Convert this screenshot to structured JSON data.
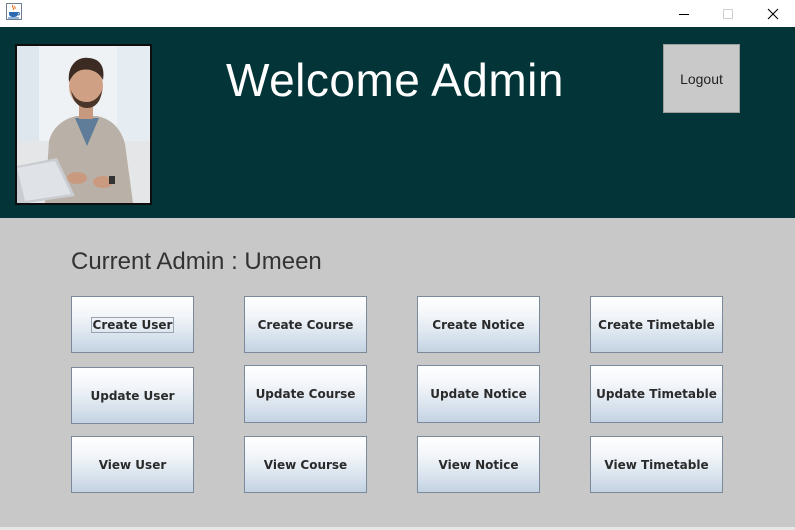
{
  "window": {
    "title": "",
    "icon": "java-cup-icon",
    "controls": [
      "minimize",
      "maximize",
      "close"
    ]
  },
  "header": {
    "welcome_text": "Welcome Admin",
    "logout_label": "Logout",
    "background": "#033538",
    "avatar": "photo of man at laptop"
  },
  "main": {
    "current_admin_text": "Current Admin : Umeen",
    "background": "#c8c8c8",
    "buttons": {
      "create_user": "Create User",
      "create_course": "Create Course",
      "create_notice": "Create Notice",
      "create_timetable": "Create Timetable",
      "update_user": "Update User",
      "update_course": "Update Course",
      "update_notice": "Update Notice",
      "update_timetable": "Update Timetable",
      "view_user": "View User",
      "view_course": "View Course",
      "view_notice": "View Notice",
      "view_timetable": "View Timetable"
    },
    "focused_button": "create_user"
  }
}
